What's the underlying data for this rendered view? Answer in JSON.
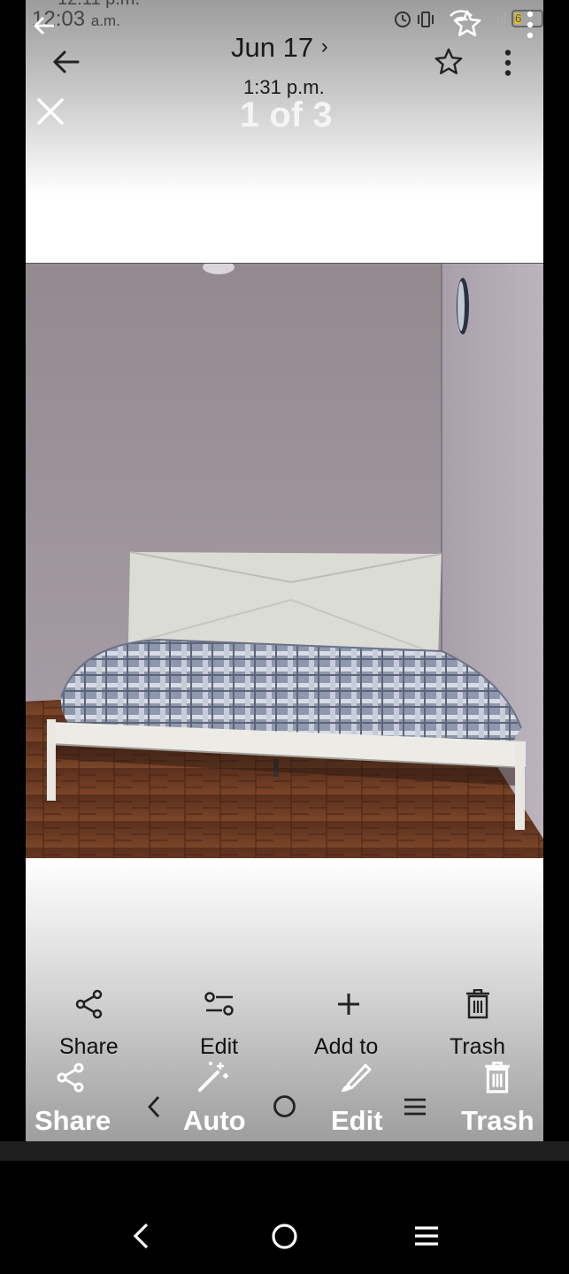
{
  "ghost_status": {
    "time_top": "12:11 p.m.",
    "time": "12:03",
    "ampm": "a.m.",
    "battery": "6"
  },
  "header": {
    "date": "Jun 17",
    "date_chevron": "›",
    "time": "1:31 p.m.",
    "counter": "1 of 3"
  },
  "action_bar": {
    "share": "Share",
    "edit": "Edit",
    "add_to": "Add to",
    "trash": "Trash"
  },
  "ghost_action_bar": {
    "share": "Share",
    "auto": "Auto",
    "edit": "Edit",
    "trash": "Trash"
  },
  "icons": {
    "back": "arrow-left-icon",
    "close": "close-icon",
    "star": "star-icon",
    "more": "more-vert-icon",
    "share": "share-icon",
    "edit": "sliders-icon",
    "add": "plus-icon",
    "trash": "trash-icon",
    "auto": "magic-wand-icon",
    "brush": "brush-icon"
  },
  "colors": {
    "wall": "#948c92",
    "floor": "#6a3a22",
    "bedding": "#8a93a8"
  }
}
